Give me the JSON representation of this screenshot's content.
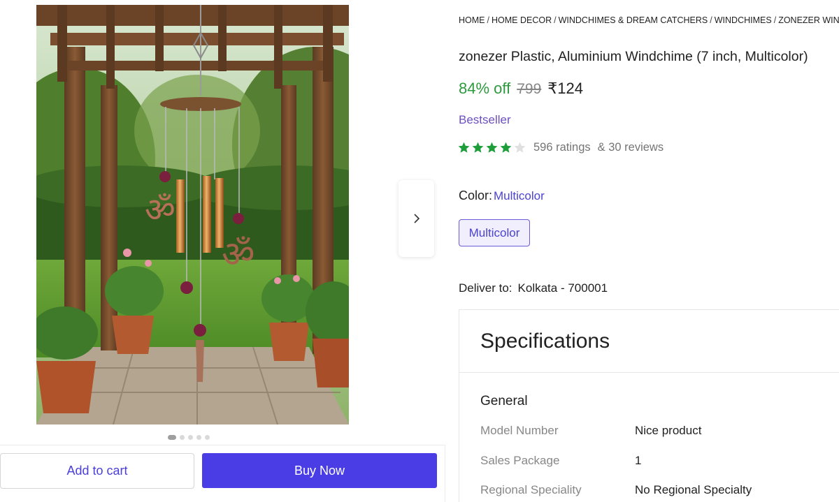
{
  "breadcrumb": [
    "HOME",
    "HOME DECOR",
    "WINDCHIMES & DREAM CATCHERS",
    "WINDCHIMES",
    "ZONEZER WIND"
  ],
  "product": {
    "title": "zonezer Plastic, Aluminium Windchime (7 inch, Multicolor)",
    "discount": "84% off",
    "mrp": "799",
    "price": "₹124",
    "badge": "Bestseller",
    "rating_value": 4,
    "rating_max": 5,
    "ratings_text": "596 ratings",
    "reviews_text": "& 30 reviews",
    "color_label": "Color:",
    "color_value": "Multicolor",
    "color_options": [
      "Multicolor"
    ],
    "deliver_label": "Deliver to:",
    "deliver_location": "Kolkata - 700001"
  },
  "gallery": {
    "image_count": 5,
    "active_index": 0
  },
  "actions": {
    "add_to_cart": "Add to cart",
    "buy_now": "Buy Now"
  },
  "specifications": {
    "heading": "Specifications",
    "section": "General",
    "rows": [
      {
        "key": "Model Number",
        "value": "Nice product"
      },
      {
        "key": "Sales Package",
        "value": "1"
      },
      {
        "key": "Regional Speciality",
        "value": "No Regional Specialty"
      }
    ]
  },
  "colors": {
    "accent": "#4a3de6",
    "discount_green": "#2e9a3e",
    "star_green": "#1e9e3a",
    "bestseller_purple": "#6c4fbf"
  },
  "icons": {
    "next": "chevron-right-icon",
    "star": "star-icon"
  }
}
